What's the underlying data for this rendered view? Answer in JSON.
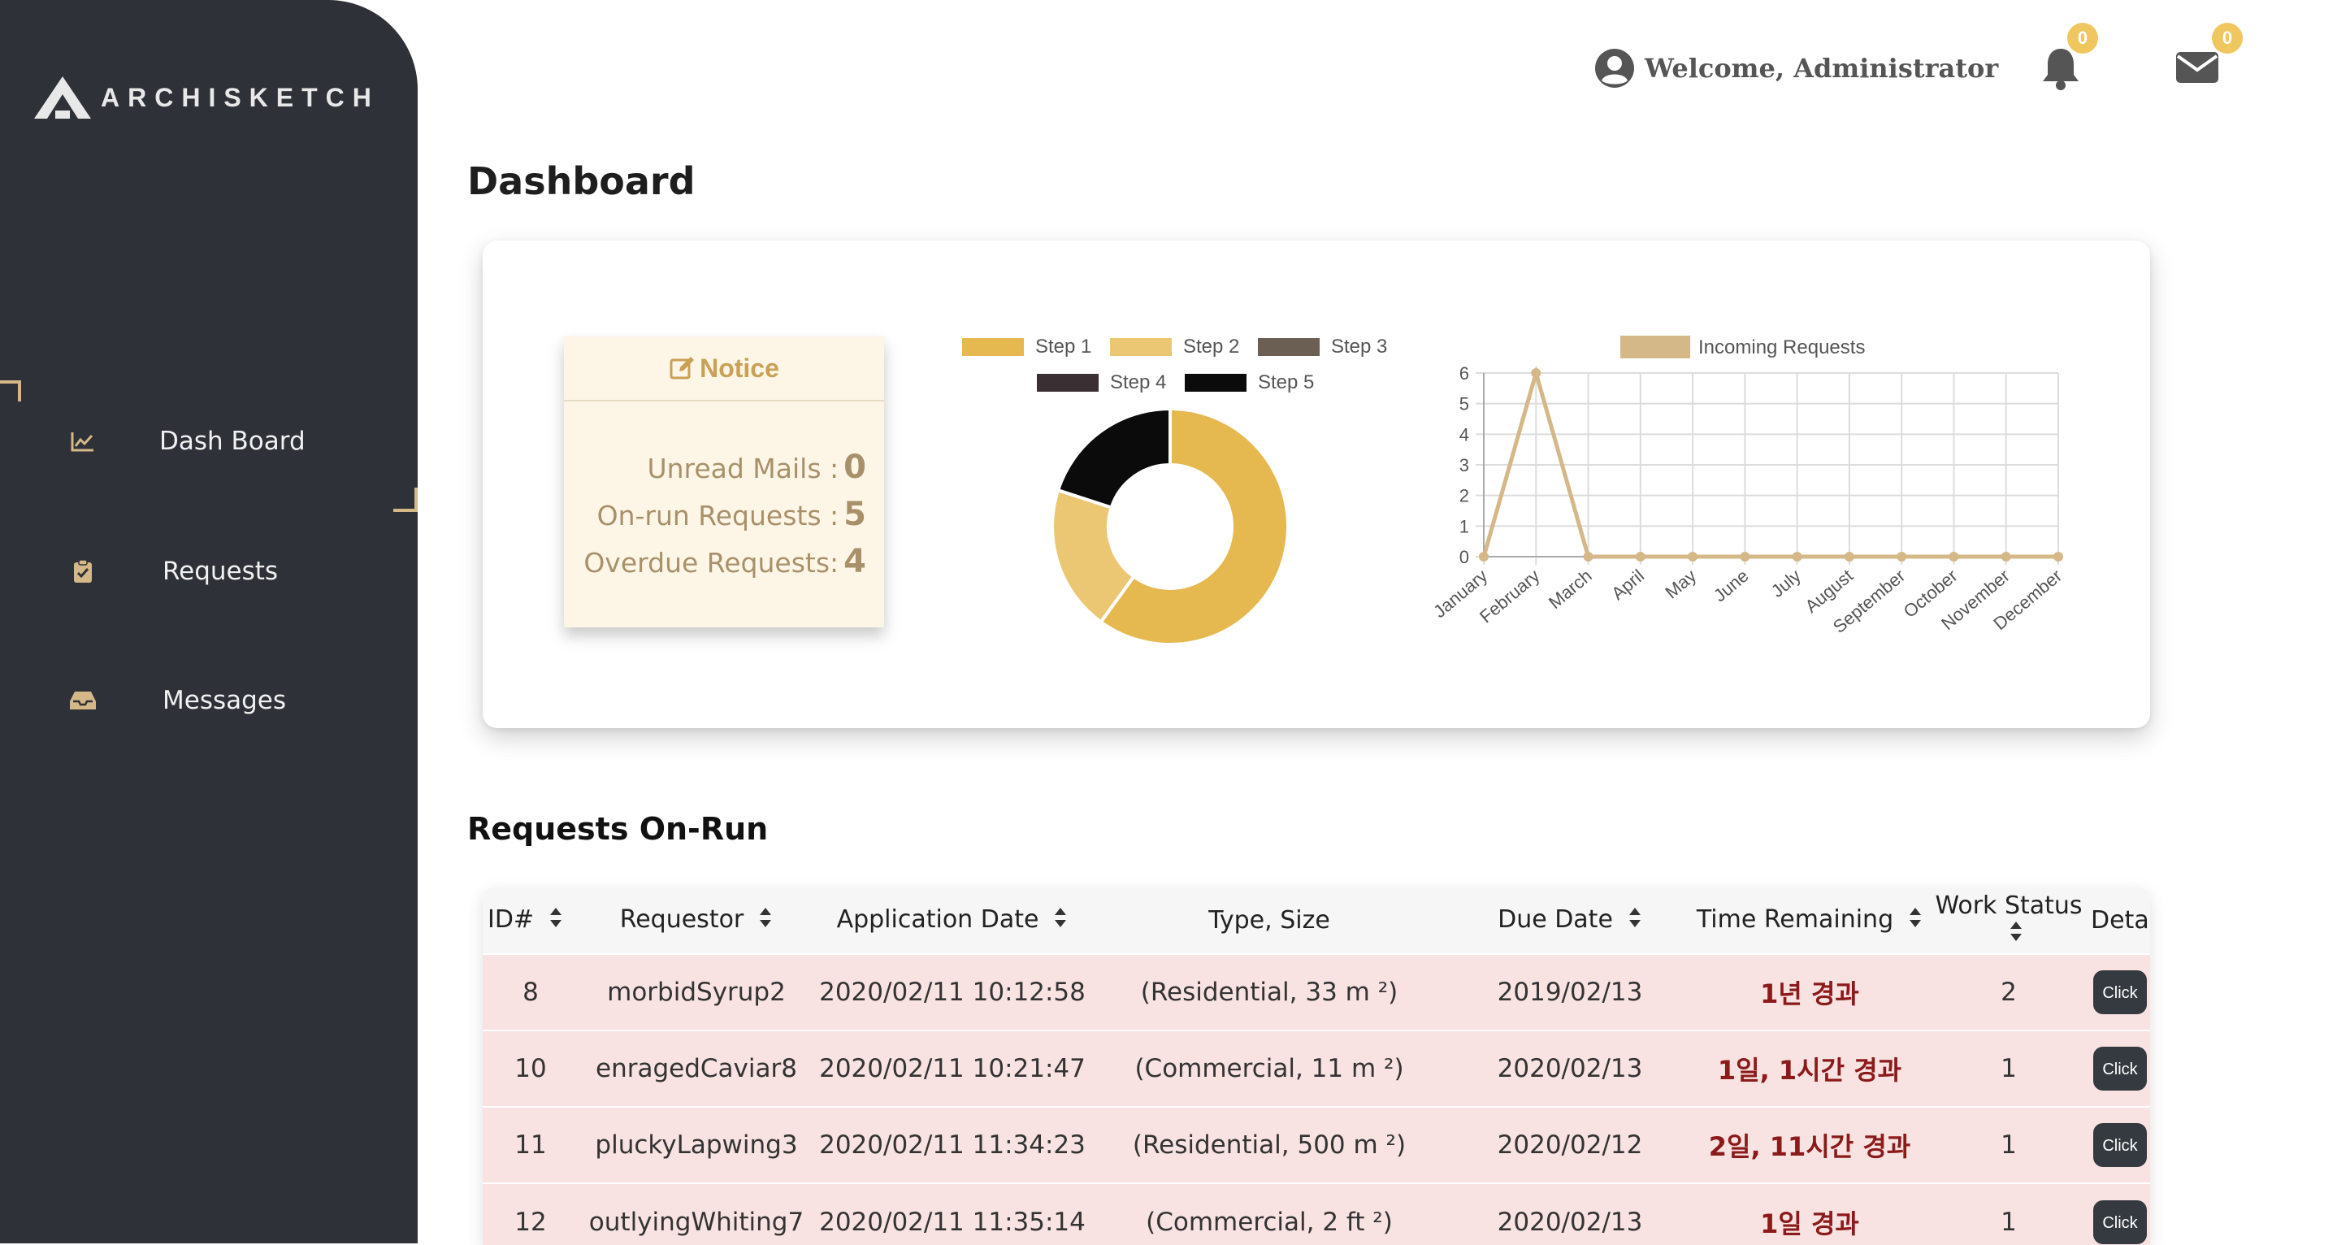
{
  "app": {
    "logo_text": "ARCHISKETCH"
  },
  "sidebar": {
    "items": [
      {
        "label": "Dash Board",
        "icon": "chart-line-icon"
      },
      {
        "label": "Requests",
        "icon": "clipboard-check-icon"
      },
      {
        "label": "Messages",
        "icon": "inbox-icon"
      }
    ]
  },
  "header": {
    "welcome": "Welcome, Administrator",
    "notifications_count": "0",
    "messages_count": "0"
  },
  "page_title": "Dashboard",
  "notice": {
    "title": "Notice",
    "unread_label": "Unread Mails",
    "unread_value": "0",
    "onrun_label": "On-run Requests",
    "onrun_value": "5",
    "overdue_label": "Overdue Requests",
    "overdue_value": "4"
  },
  "chart_data": [
    {
      "type": "pie",
      "donut": true,
      "legend_position": "top",
      "labels": [
        "Step 1",
        "Step 2",
        "Step 3",
        "Step 4",
        "Step 5"
      ],
      "values": [
        3,
        1,
        0,
        0,
        1
      ],
      "colors": [
        "#e5b94f",
        "#ebc774",
        "#6b5e52",
        "#3a3033",
        "#0b0b0b"
      ]
    },
    {
      "type": "line",
      "legend_position": "top",
      "series": [
        {
          "name": "Incoming Requests",
          "color": "#d4b887",
          "values": [
            0,
            6,
            0,
            0,
            0,
            0,
            0,
            0,
            0,
            0,
            0,
            0
          ]
        }
      ],
      "categories": [
        "January",
        "February",
        "March",
        "April",
        "May",
        "June",
        "July",
        "August",
        "September",
        "October",
        "November",
        "December"
      ],
      "ylim": [
        0,
        6
      ],
      "yticks": [
        0,
        1,
        2,
        3,
        4,
        5,
        6
      ],
      "grid": true
    }
  ],
  "requests_title": "Requests On-Run",
  "table": {
    "headers": [
      "ID#",
      "Requestor",
      "Application Date",
      "Type, Size",
      "Due Date",
      "Time Remaining",
      "Work Status",
      "Detail"
    ],
    "rows": [
      {
        "id": "8",
        "requestor": "morbidSyrup2",
        "app_date": "2020/02/11 10:12:58",
        "type_size": "(Residential, 33 m ²)",
        "due": "2019/02/13",
        "remaining": "1년 경과",
        "status": "2",
        "detail": "Click"
      },
      {
        "id": "10",
        "requestor": "enragedCaviar8",
        "app_date": "2020/02/11 10:21:47",
        "type_size": "(Commercial, 11 m ²)",
        "due": "2020/02/13",
        "remaining": "1일, 1시간 경과",
        "status": "1",
        "detail": "Click"
      },
      {
        "id": "11",
        "requestor": "pluckyLapwing3",
        "app_date": "2020/02/11 11:34:23",
        "type_size": "(Residential, 500 m ²)",
        "due": "2020/02/12",
        "remaining": "2일, 11시간 경과",
        "status": "1",
        "detail": "Click"
      },
      {
        "id": "12",
        "requestor": "outlyingWhiting7",
        "app_date": "2020/02/11 11:35:14",
        "type_size": "(Commercial, 2 ft ²)",
        "due": "2020/02/13",
        "remaining": "1일 경과",
        "status": "1",
        "detail": "Click"
      }
    ]
  }
}
